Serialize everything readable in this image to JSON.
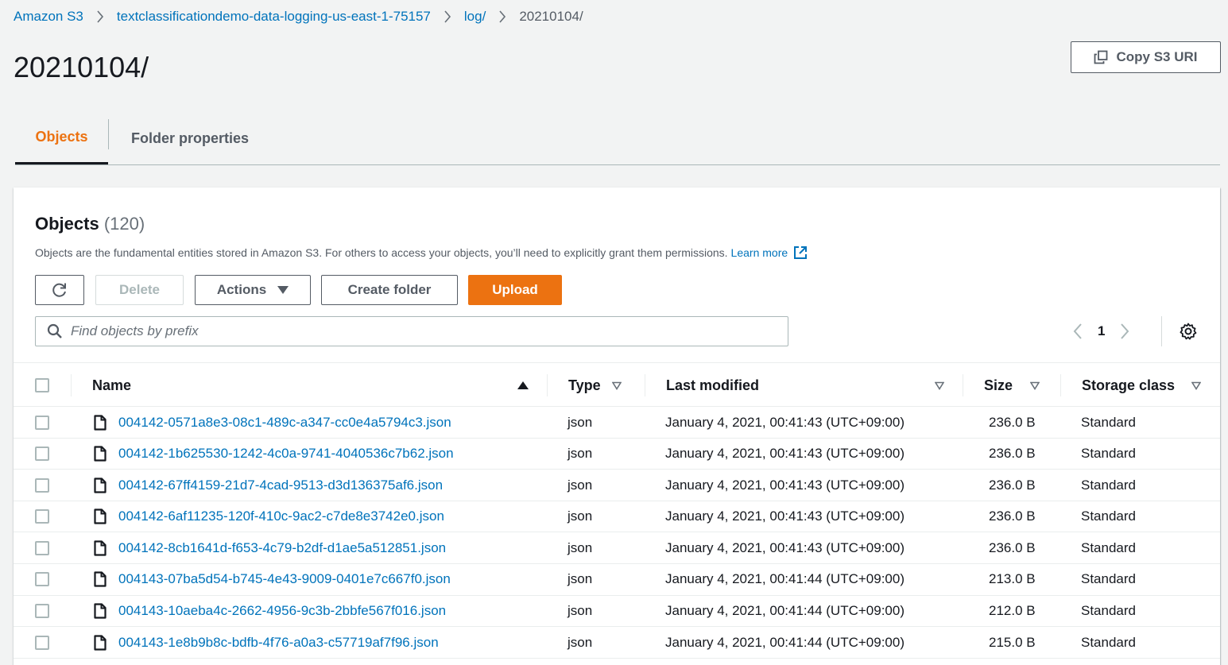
{
  "breadcrumb": {
    "items": [
      "Amazon S3",
      "textclassificationdemo-data-logging-us-east-1-75157",
      "log/"
    ],
    "current": "20210104/"
  },
  "page": {
    "title": "20210104/"
  },
  "copy_button": {
    "label": "Copy S3 URI",
    "icon": "copy-icon"
  },
  "tabs": [
    {
      "label": "Objects",
      "active": true
    },
    {
      "label": "Folder properties",
      "active": false
    }
  ],
  "panel": {
    "title": "Objects",
    "count": "(120)",
    "description": "Objects are the fundamental entities stored in Amazon S3. For others to access your objects, you’ll need to explicitly grant them permissions.",
    "learn_more": "Learn more"
  },
  "toolbar": {
    "refresh_icon": "refresh-icon",
    "delete_label": "Delete",
    "actions_label": "Actions",
    "create_folder_label": "Create folder",
    "upload_label": "Upload"
  },
  "search": {
    "placeholder": "Find objects by prefix"
  },
  "pagination": {
    "current_page": "1"
  },
  "colors": {
    "link": "#0073bb",
    "accent": "#ec7211",
    "text": "#16191f",
    "muted": "#545b64"
  },
  "table": {
    "columns": [
      "Name",
      "Type",
      "Last modified",
      "Size",
      "Storage class"
    ],
    "rows": [
      {
        "name": "004142-0571a8e3-08c1-489c-a347-cc0e4a5794c3.json",
        "type": "json",
        "modified": "January 4, 2021, 00:41:43 (UTC+09:00)",
        "size": "236.0 B",
        "storage": "Standard"
      },
      {
        "name": "004142-1b625530-1242-4c0a-9741-4040536c7b62.json",
        "type": "json",
        "modified": "January 4, 2021, 00:41:43 (UTC+09:00)",
        "size": "236.0 B",
        "storage": "Standard"
      },
      {
        "name": "004142-67ff4159-21d7-4cad-9513-d3d136375af6.json",
        "type": "json",
        "modified": "January 4, 2021, 00:41:43 (UTC+09:00)",
        "size": "236.0 B",
        "storage": "Standard"
      },
      {
        "name": "004142-6af11235-120f-410c-9ac2-c7de8e3742e0.json",
        "type": "json",
        "modified": "January 4, 2021, 00:41:43 (UTC+09:00)",
        "size": "236.0 B",
        "storage": "Standard"
      },
      {
        "name": "004142-8cb1641d-f653-4c79-b2df-d1ae5a512851.json",
        "type": "json",
        "modified": "January 4, 2021, 00:41:43 (UTC+09:00)",
        "size": "236.0 B",
        "storage": "Standard"
      },
      {
        "name": "004143-07ba5d54-b745-4e43-9009-0401e7c667f0.json",
        "type": "json",
        "modified": "January 4, 2021, 00:41:44 (UTC+09:00)",
        "size": "213.0 B",
        "storage": "Standard"
      },
      {
        "name": "004143-10aeba4c-2662-4956-9c3b-2bbfe567f016.json",
        "type": "json",
        "modified": "January 4, 2021, 00:41:44 (UTC+09:00)",
        "size": "212.0 B",
        "storage": "Standard"
      },
      {
        "name": "004143-1e8b9b8c-bdfb-4f76-a0a3-c57719af7f96.json",
        "type": "json",
        "modified": "January 4, 2021, 00:41:44 (UTC+09:00)",
        "size": "215.0 B",
        "storage": "Standard"
      }
    ]
  }
}
